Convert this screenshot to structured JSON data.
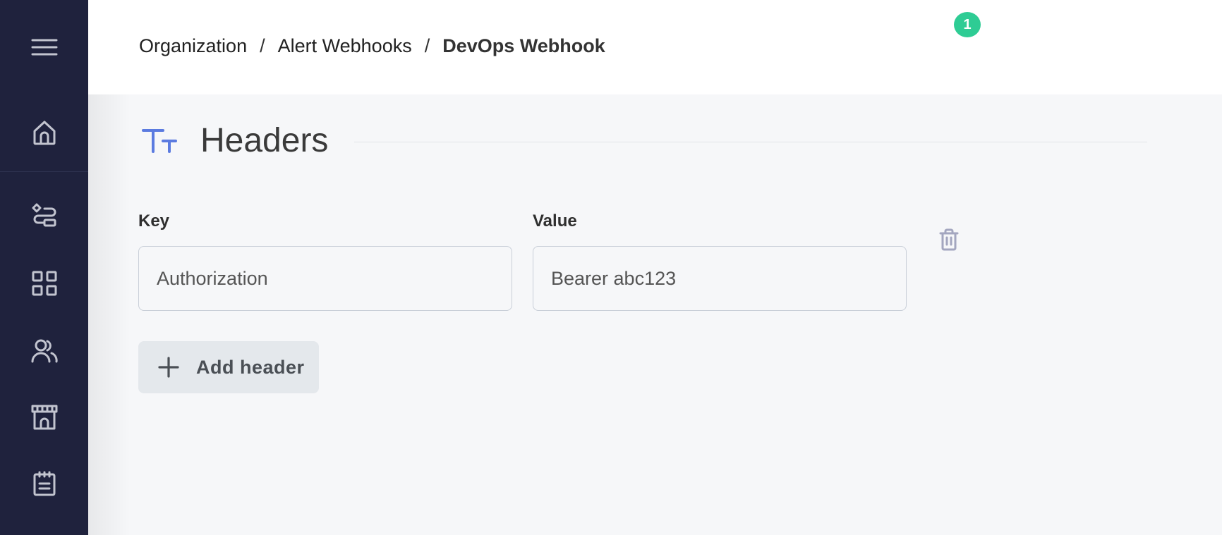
{
  "sidebar": {
    "menu_icon": "hamburger-menu-icon",
    "items": [
      {
        "id": "home",
        "icon": "home-icon"
      },
      {
        "id": "workflows",
        "icon": "workflow-icon"
      },
      {
        "id": "dashboard",
        "icon": "grid-icon"
      },
      {
        "id": "users",
        "icon": "users-icon"
      },
      {
        "id": "store",
        "icon": "storefront-icon"
      },
      {
        "id": "notes",
        "icon": "notepad-icon"
      }
    ],
    "background_color": "#1f223d"
  },
  "header": {
    "breadcrumb": [
      {
        "label": "Organization"
      },
      {
        "label": "Alert Webhooks"
      },
      {
        "label": "DevOps Webhook"
      }
    ],
    "separator": "/",
    "notifications": {
      "icon": "bell-icon",
      "count": "1",
      "badge_color": "#2ecc94"
    },
    "help_icon": "lifebuoy-icon",
    "tips_icon": "lightbulb-icon",
    "avatar": "user-avatar"
  },
  "section": {
    "title": "Headers",
    "icon": "text-size-icon",
    "accent_color": "#5b7be0"
  },
  "headers_form": {
    "key_label": "Key",
    "value_label": "Value",
    "rows": [
      {
        "key": "Authorization",
        "value": "Bearer abc123"
      }
    ],
    "delete_icon": "trash-icon",
    "add_button_label": "Add header",
    "add_icon": "plus-icon"
  }
}
